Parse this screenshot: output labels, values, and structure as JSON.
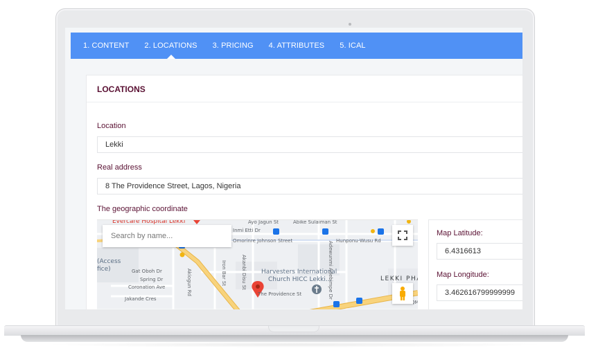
{
  "tabs": [
    {
      "label": "1. CONTENT",
      "active": false
    },
    {
      "label": "2. LOCATIONS",
      "active": true
    },
    {
      "label": "3. PRICING",
      "active": false
    },
    {
      "label": "4. ATTRIBUTES",
      "active": false
    },
    {
      "label": "5. ICAL",
      "active": false
    }
  ],
  "panel": {
    "title": "LOCATIONS",
    "location": {
      "label": "Location",
      "value": "Lekki"
    },
    "real_address": {
      "label": "Real address",
      "value": "8 The Providence Street, Lagos, Nigeria"
    },
    "geo_label": "The geographic coordinate"
  },
  "map": {
    "search_placeholder": "Search by name...",
    "labels": {
      "hospital": "Evercare Hospital Lekki",
      "ayo": "Ayo Jagun St",
      "abike": "Abike Sulaiman St",
      "inmi": "Inmi Etti Dr",
      "omorinre": "Omorinre Johnson Street",
      "hunponu": "Hunponu-Wusu Rd",
      "access1": "(Access",
      "access2": "fice)",
      "gat": "Gat Oboh Dr",
      "spring": "Spring Dr",
      "coronation": "Coronation Ave",
      "jakande": "Jakande Cres",
      "akiogun": "Akiogun Rd",
      "ironbar": "Iron Bar St",
      "akanbi": "Akanbi Disu St",
      "adewunmi": "Adewunmi Adebimpe Dr",
      "church1": "Harvesters International",
      "church2": "Church HICC Lekki...",
      "providence": "The Providence St",
      "lekki_phase": "LEKKI PHA",
      "qm": "QM"
    },
    "colors": {
      "road": "#f4c04f",
      "pin": "#ea4335",
      "transit": "#1a73e8"
    }
  },
  "coordinates": {
    "latitude": {
      "label": "Map Latitude:",
      "value": "6.4316613"
    },
    "longitude": {
      "label": "Map Longitude:",
      "value": "3.462616799999999"
    }
  },
  "theme": {
    "tab_bar": "#5091f5",
    "label_color": "#5a1133"
  }
}
